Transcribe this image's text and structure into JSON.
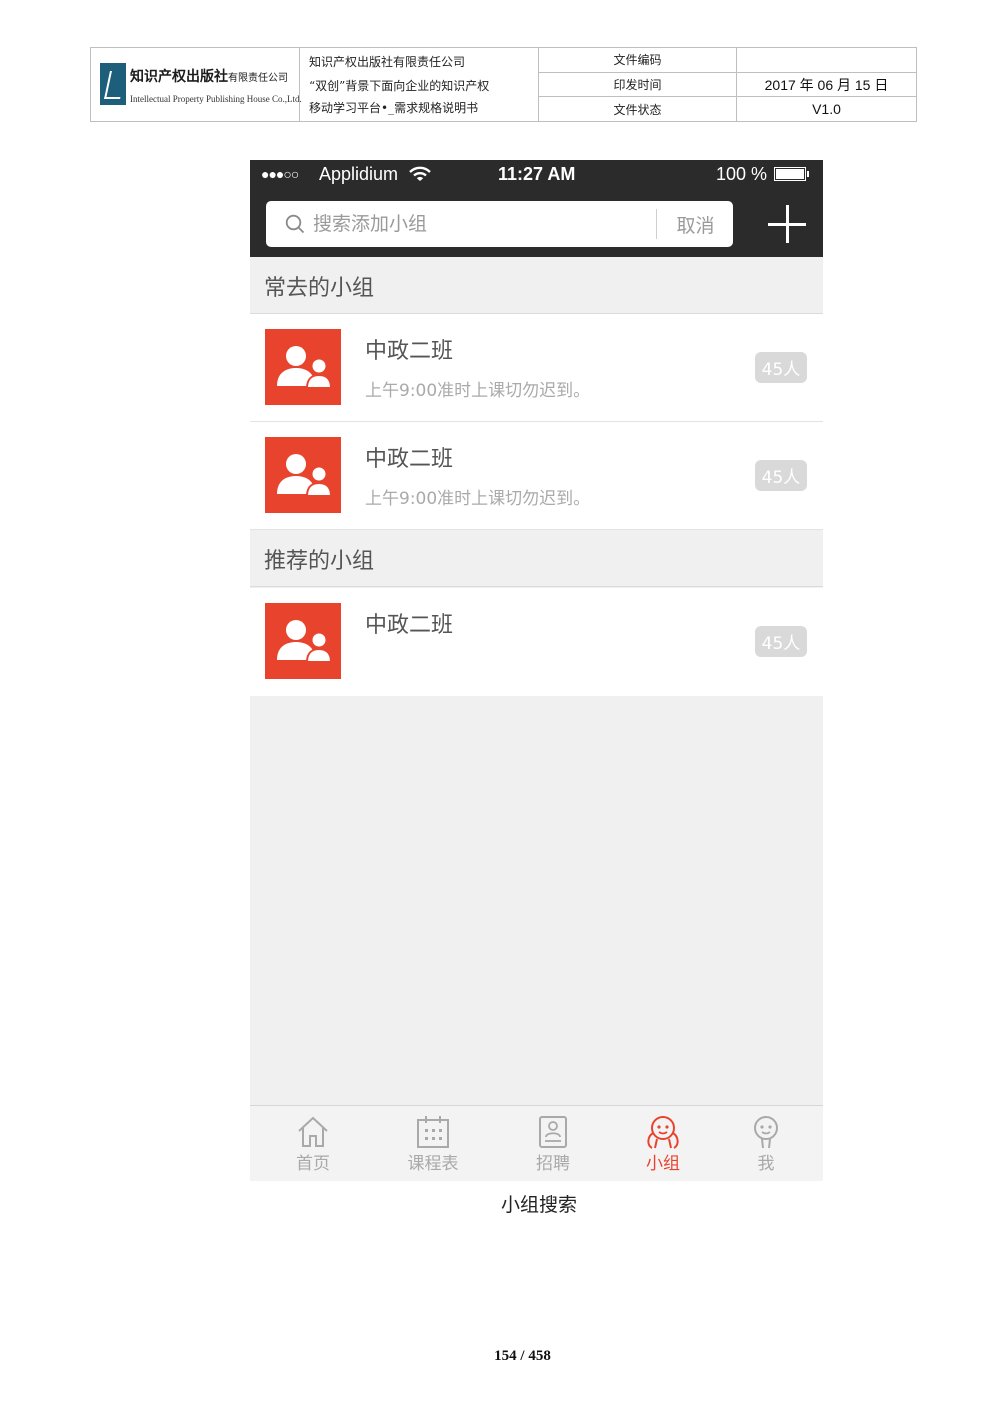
{
  "header": {
    "company_cn": "知识产权出版社",
    "company_cn_suffix": "有限责任公司",
    "company_en": "Intellectual Property Publishing House Co.,Ltd.",
    "title_line1": "知识产权出版社有限责任公司",
    "title_line2": "“双创”背景下面向企业的知识产权",
    "title_line3": "移动学习平台•_需求规格说明书",
    "labels": [
      "文件编码",
      "印发时间",
      "文件状态"
    ],
    "values": [
      "",
      "2017 年 06 月 15 日",
      "V1.0"
    ]
  },
  "status_bar": {
    "signal": "●●●○○",
    "carrier": "Applidium",
    "time": "11:27 AM",
    "battery": "100 %"
  },
  "search": {
    "placeholder": "搜索添加小组",
    "cancel_label": "取消"
  },
  "sections": [
    {
      "title": "常去的小组",
      "groups": [
        {
          "name": "中政二班",
          "desc": "上午9:00准时上课切勿迟到。",
          "count": "45人"
        },
        {
          "name": "中政二班",
          "desc": "上午9:00准时上课切勿迟到。",
          "count": "45人"
        }
      ]
    },
    {
      "title": "推荐的小组",
      "groups": [
        {
          "name": "中政二班",
          "desc": "",
          "count": "45人"
        }
      ]
    }
  ],
  "tabs": [
    {
      "label": "首页",
      "icon": "home-icon",
      "active": false
    },
    {
      "label": "课程表",
      "icon": "calendar-icon",
      "active": false
    },
    {
      "label": "招聘",
      "icon": "resume-icon",
      "active": false
    },
    {
      "label": "小组",
      "icon": "group-icon",
      "active": true
    },
    {
      "label": "我",
      "icon": "profile-icon",
      "active": false
    }
  ],
  "colors": {
    "accent": "#e8442d",
    "topbar": "#2b2b2b",
    "background": "#f0f0f0"
  },
  "caption": "小组搜索",
  "page_number": "154 / 458"
}
